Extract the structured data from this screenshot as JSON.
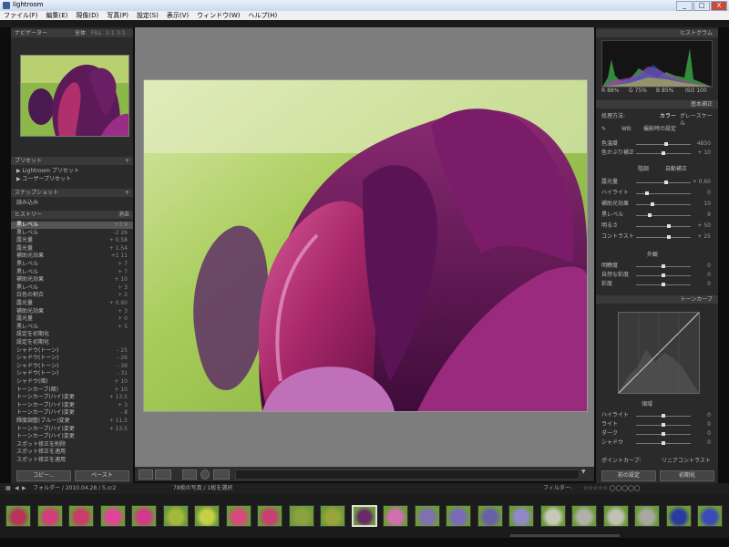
{
  "window": {
    "title": "lightroom",
    "min": "_",
    "max": "□",
    "close": "X"
  },
  "menu": [
    "ファイル(F)",
    "編集(E)",
    "現像(D)",
    "写真(P)",
    "設定(S)",
    "表示(V)",
    "ウィンドウ(W)",
    "ヘルプ(H)"
  ],
  "left_panel": {
    "navigator": {
      "label": "ナビゲーター",
      "zoom_fit": "全体",
      "zoom_fill": "FILL",
      "z1": "1:1",
      "z3": "3:1"
    },
    "presets": {
      "label": "プリセット",
      "items": [
        "Lightroom プリセット",
        "ユーザープリセット"
      ]
    },
    "snapshots": {
      "label": "スナップショット",
      "item": "読み込み"
    },
    "history": {
      "label": "ヒストリー",
      "clear": "消去",
      "items": [
        {
          "name": "黒レベル",
          "v1": "+3",
          "v2": "9",
          "sel": true
        },
        {
          "name": "黒レベル",
          "v1": "-2",
          "v2": "26",
          "sel": false
        },
        {
          "name": "露光量",
          "v1": "+",
          "v2": "0.58",
          "sel": false
        },
        {
          "name": "露光量",
          "v1": "+",
          "v2": "1.54",
          "sel": false
        },
        {
          "name": "補助光効果",
          "v1": "+1",
          "v2": "11",
          "sel": false
        },
        {
          "name": "黒レベル",
          "v1": "+",
          "v2": "7",
          "sel": false
        },
        {
          "name": "黒レベル",
          "v1": "+",
          "v2": "7",
          "sel": false
        },
        {
          "name": "補助光効果",
          "v1": "+",
          "v2": "10",
          "sel": false
        },
        {
          "name": "黒レベル",
          "v1": "+",
          "v2": "3",
          "sel": false
        },
        {
          "name": "白色の割合",
          "v1": "+",
          "v2": "2",
          "sel": false
        },
        {
          "name": "露光量",
          "v1": "+",
          "v2": "0.60",
          "sel": false
        },
        {
          "name": "補助光効果",
          "v1": "+",
          "v2": "3",
          "sel": false
        },
        {
          "name": "露光量",
          "v1": "+",
          "v2": "0",
          "sel": false
        },
        {
          "name": "黒レベル",
          "v1": "+",
          "v2": "5",
          "sel": false
        },
        {
          "name": "設定を初期化",
          "v1": "",
          "v2": "",
          "sel": false
        },
        {
          "name": "設定を初期化",
          "v1": "",
          "v2": "",
          "sel": false
        },
        {
          "name": "シャドウ(トーン)",
          "v1": "-",
          "v2": "25",
          "sel": false
        },
        {
          "name": "シャドウ(トーン)",
          "v1": "-",
          "v2": "26",
          "sel": false
        },
        {
          "name": "シャドウ(トーン)",
          "v1": "-",
          "v2": "39",
          "sel": false
        },
        {
          "name": "シャドウ(トーン)",
          "v1": "-",
          "v2": "31",
          "sel": false
        },
        {
          "name": "シャドウ(暗)",
          "v1": "+",
          "v2": "10",
          "sel": false
        },
        {
          "name": "トーンカーブ(暗)",
          "v1": "+",
          "v2": "10",
          "sel": false
        },
        {
          "name": "トーンカーブ(ハイ)変更",
          "v1": "+",
          "v2": "13.5",
          "sel": false
        },
        {
          "name": "トーンカーブ(ハイ)変更",
          "v1": "+",
          "v2": "3",
          "sel": false
        },
        {
          "name": "トーンカーブ(ハイ)変更",
          "v1": "-",
          "v2": "8",
          "sel": false
        },
        {
          "name": "輝度調整(ブルー)変更",
          "v1": "+",
          "v2": "11.5",
          "sel": false
        },
        {
          "name": "トーンカーブ(ハイ)変更",
          "v1": "+",
          "v2": "13.5",
          "sel": false
        },
        {
          "name": "トーンカーブ(ハイ)変更",
          "v1": "",
          "v2": "",
          "sel": false
        },
        {
          "name": "スポット修正を削除",
          "v1": "",
          "v2": "",
          "sel": false
        },
        {
          "name": "スポット修正を適用",
          "v1": "",
          "v2": "",
          "sel": false
        },
        {
          "name": "スポット修正を適用",
          "v1": "",
          "v2": "",
          "sel": false
        }
      ]
    },
    "copy_btn": "コピー...",
    "paste_btn": "ペースト"
  },
  "right_panel": {
    "histogram_label": "ヒストグラム",
    "histo_readouts": [
      "R 88%",
      "G 75%",
      "B 85%",
      "ISO 100"
    ],
    "basic_label": "基本補正",
    "treatment": {
      "label": "処理方法:",
      "color": "カラー",
      "bw": "グレースケール"
    },
    "wb": {
      "label": "WB:",
      "value": "撮影時の設定"
    },
    "sliders_wb": [
      {
        "label": "色温度",
        "value": "4850",
        "pos": 0.55
      },
      {
        "label": "色かぶり補正",
        "value": "+ 10",
        "pos": 0.5
      }
    ],
    "tone_label": "階調",
    "auto_tone": "自動補正",
    "sliders_tone": [
      {
        "label": "露光量",
        "value": "+ 0.60",
        "pos": 0.55
      },
      {
        "label": "ハイライト",
        "value": "0",
        "pos": 0.2
      },
      {
        "label": "補助光効果",
        "value": "10",
        "pos": 0.3
      },
      {
        "label": "黒レベル",
        "value": "9",
        "pos": 0.25
      },
      {
        "label": "明るさ",
        "value": "+ 50",
        "pos": 0.6
      },
      {
        "label": "コントラスト",
        "value": "+ 25",
        "pos": 0.6
      }
    ],
    "presence_label": "外観",
    "sliders_presence": [
      {
        "label": "明瞭度",
        "value": "0",
        "pos": 0.5
      },
      {
        "label": "自然な彩度",
        "value": "0",
        "pos": 0.5
      },
      {
        "label": "彩度",
        "value": "0",
        "pos": 0.5
      }
    ],
    "tonecurve_label": "トーンカーブ",
    "curve_region_label": "領域",
    "sliders_curve": [
      {
        "label": "ハイライト",
        "value": "0",
        "pos": 0.5
      },
      {
        "label": "ライト",
        "value": "0",
        "pos": 0.5
      },
      {
        "label": "ダーク",
        "value": "0",
        "pos": 0.5
      },
      {
        "label": "シャドウ",
        "value": "0",
        "pos": 0.5
      }
    ],
    "point_curve_label": "ポイントカーブ:",
    "point_curve_value": "リニアコントラスト",
    "prev_btn": "前の設定",
    "reset_btn": "初期化"
  },
  "filmstrip": {
    "path": "フォルダー / 2010.04.28 / 5.cr2",
    "count": "78枚の写真 / 1枚を選択",
    "filter": "フィルター:",
    "thumbs": [
      "#b8345a",
      "#d23d7a",
      "#cc3c6a",
      "#e2449a",
      "#d43888",
      "#a4b83c",
      "#c4d048",
      "#d84a7c",
      "#c84070",
      "#8ea040",
      "#9aa43a",
      "#6a2a6a",
      "#d070b0",
      "#8070b0",
      "#7a6ab8",
      "#6a60a8",
      "#9088c8",
      "#c8c8b8",
      "#b0b0a8",
      "#c0c0b4",
      "#a8a8a0",
      "#2a3aa0",
      "#3a4ab8"
    ],
    "selected_index": 11
  },
  "colors": {
    "accent": "#c0c0c0",
    "panel": "#2a2a2a",
    "background": "#7d7d7d"
  }
}
